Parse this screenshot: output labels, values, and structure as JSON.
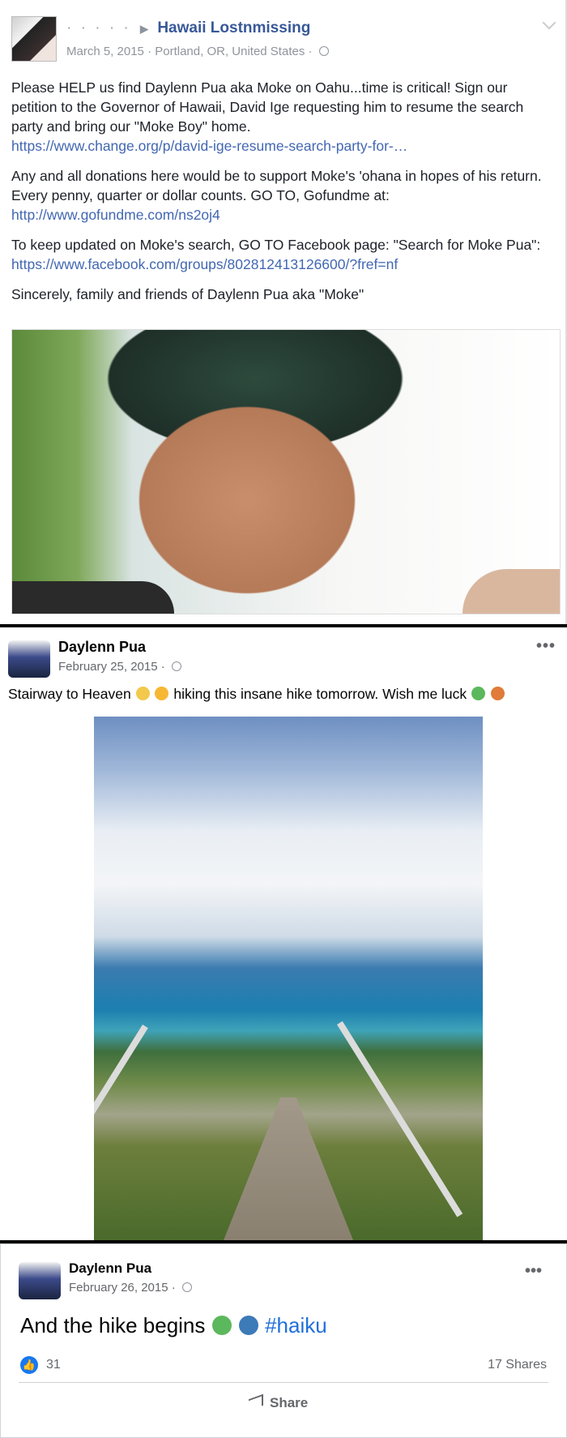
{
  "post1": {
    "author_obscured": "· · · · ·",
    "group": "Hawaii Lostnmissing",
    "date": "March 5, 2015",
    "location": "Portland, OR, United States",
    "paragraph1": "Please HELP us find Daylenn Pua aka Moke on Oahu...time is critical! Sign our petition to the Governor of Hawaii, David Ige requesting him to resume the search party and bring our \"Moke Boy\" home.",
    "link1": "https://www.change.org/p/david-ige-resume-search-party-for-…",
    "paragraph2": "Any and all donations here would be to support Moke's 'ohana in hopes of his return. Every penny, quarter or dollar counts. GO TO, Gofundme at:",
    "link2": "http://www.gofundme.com/ns2oj4",
    "paragraph3": "To keep updated on Moke's search, GO TO Facebook page: \"Search for Moke Pua\": ",
    "link3": "https://www.facebook.com/groups/802812413126600/?fref=nf",
    "paragraph4": "Sincerely, family and friends of Daylenn Pua aka \"Moke\""
  },
  "post2": {
    "author": "Daylenn Pua",
    "date": "February 25, 2015 ·",
    "text_before": "Stairway to Heaven ",
    "text_after": " hiking this insane hike tomorrow. Wish me luck "
  },
  "post3": {
    "author": "Daylenn Pua",
    "date": "February 26, 2015 ·",
    "text": "And the hike begins ",
    "hashtag": "#haiku",
    "likes": "31",
    "shares": "17 Shares",
    "share_label": "Share"
  },
  "icons": {
    "like": "like-icon",
    "globe": "globe-icon",
    "more": "more-options-icon",
    "share": "share-icon"
  },
  "colors": {
    "link": "#4267b2",
    "group_link": "#385898",
    "hashtag": "#216fdb",
    "like_blue": "#1877f2"
  }
}
